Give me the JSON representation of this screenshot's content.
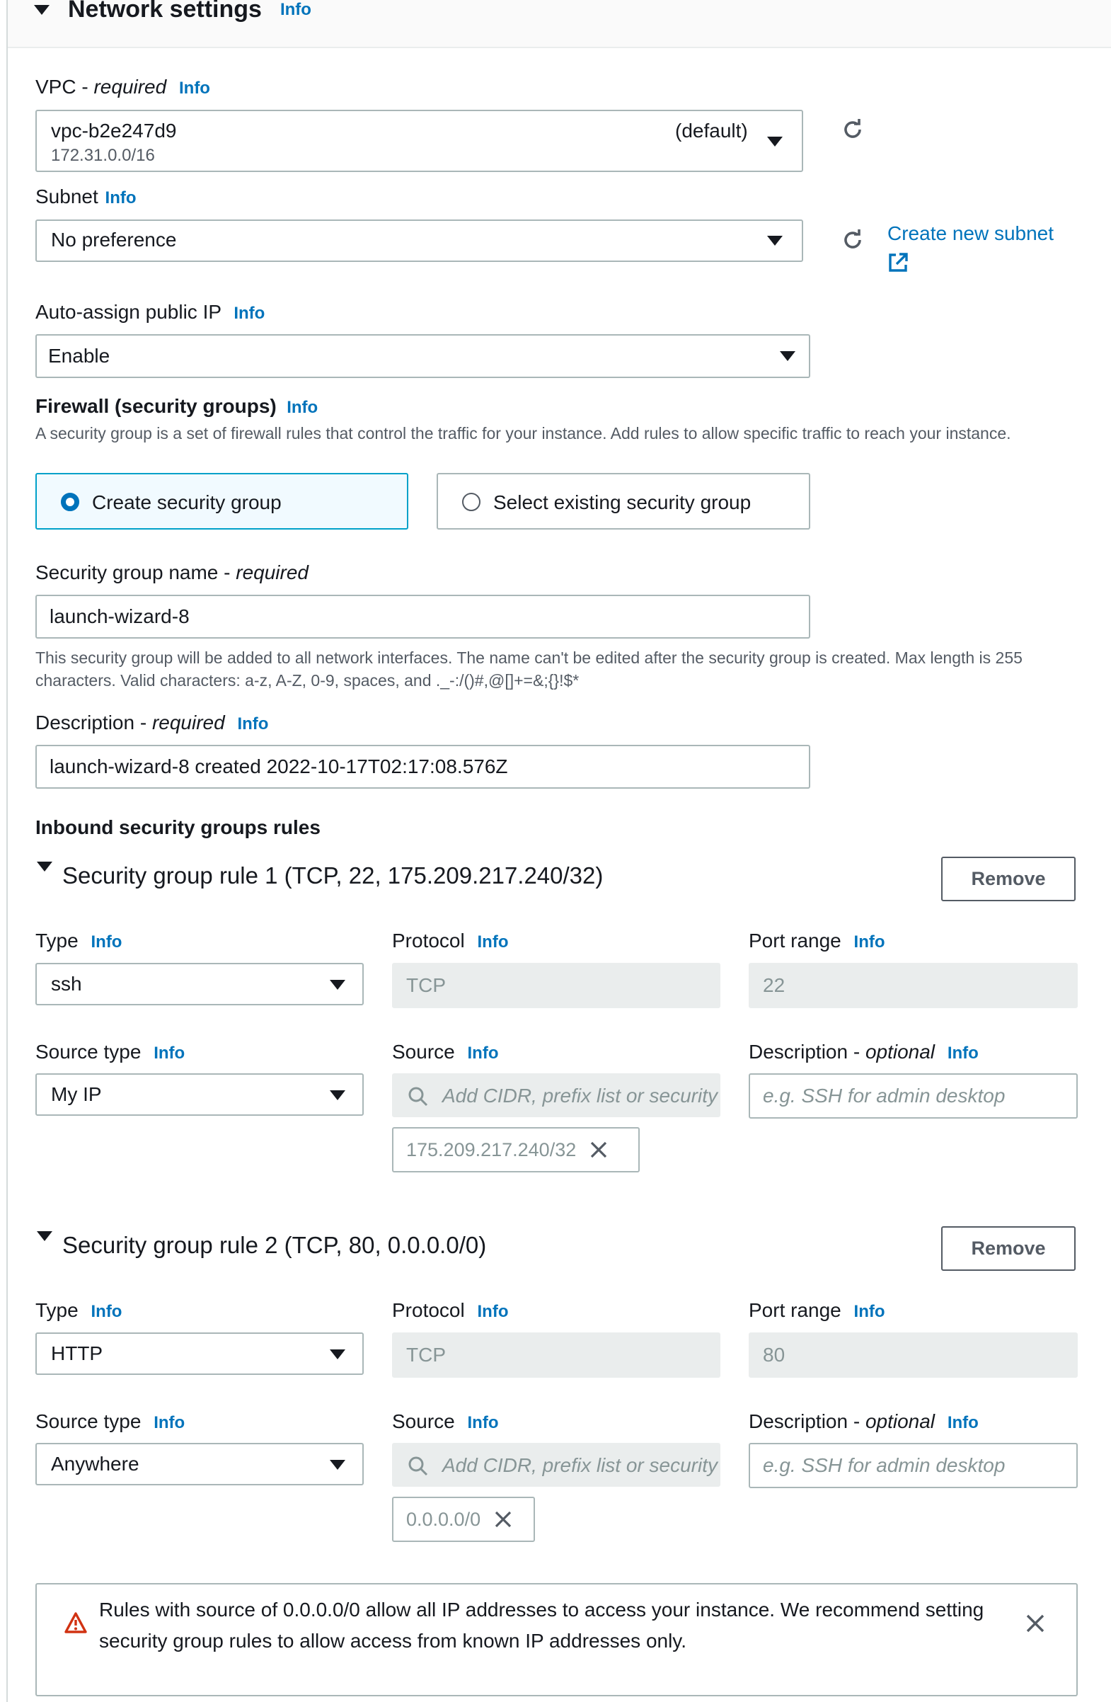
{
  "section": {
    "title": "Network settings",
    "info": "Info"
  },
  "vpc": {
    "label": "VPC - ",
    "required": "required",
    "info": "Info",
    "value": "vpc-b2e247d9",
    "cidr": "172.31.0.0/16",
    "tag": "(default)"
  },
  "subnet": {
    "label": "Subnet",
    "info": "Info",
    "value": "No preference",
    "create_link": "Create new subnet"
  },
  "auto_ip": {
    "label": "Auto-assign public IP",
    "info": "Info",
    "value": "Enable"
  },
  "firewall": {
    "title": "Firewall (security groups)",
    "info": "Info",
    "help": "A security group is a set of firewall rules that control the traffic for your instance. Add rules to allow specific traffic to reach your instance.",
    "options": [
      {
        "label": "Create security group",
        "selected": true
      },
      {
        "label": "Select existing security group",
        "selected": false
      }
    ]
  },
  "sg_name": {
    "label": "Security group name - ",
    "required": "required",
    "value": "launch-wizard-8",
    "help": "This security group will be added to all network interfaces. The name can't be edited after the security group is created. Max length is 255 characters. Valid characters: a-z, A-Z, 0-9, spaces, and ._-:/()#,@[]+=&;{}!$*"
  },
  "description": {
    "label": "Description - ",
    "required": "required",
    "info": "Info",
    "value": "launch-wizard-8 created 2022-10-17T02:17:08.576Z"
  },
  "inbound": {
    "title": "Inbound security groups rules",
    "rules": [
      {
        "title": "Security group rule 1 (TCP, 22, 175.209.217.240/32)",
        "remove": "Remove",
        "type_label": "Type",
        "type_value": "ssh",
        "protocol_label": "Protocol",
        "protocol_value": "TCP",
        "port_label": "Port range",
        "port_value": "22",
        "source_type_label": "Source type",
        "source_type_value": "My IP",
        "source_label": "Source",
        "source_placeholder": "Add CIDR, prefix list or security",
        "desc_label": "Description - ",
        "desc_optional": "optional",
        "desc_placeholder": "e.g. SSH for admin desktop",
        "token": "175.209.217.240/32",
        "info": "Info"
      },
      {
        "title": "Security group rule 2 (TCP, 80, 0.0.0.0/0)",
        "remove": "Remove",
        "type_label": "Type",
        "type_value": "HTTP",
        "protocol_label": "Protocol",
        "protocol_value": "TCP",
        "port_label": "Port range",
        "port_value": "80",
        "source_type_label": "Source type",
        "source_type_value": "Anywhere",
        "source_label": "Source",
        "source_placeholder": "Add CIDR, prefix list or security",
        "desc_label": "Description - ",
        "desc_optional": "optional",
        "desc_placeholder": "e.g. SSH for admin desktop",
        "token": "0.0.0.0/0",
        "info": "Info"
      }
    ]
  },
  "warning": {
    "line1": "Rules with source of 0.0.0.0/0 allow all IP addresses to access your instance. We recommend setting",
    "line2": "security group rules to allow access from known IP addresses only."
  },
  "colors": {
    "link": "#0073bb",
    "selected_bg": "#f1faff",
    "warning": "#d13212"
  }
}
